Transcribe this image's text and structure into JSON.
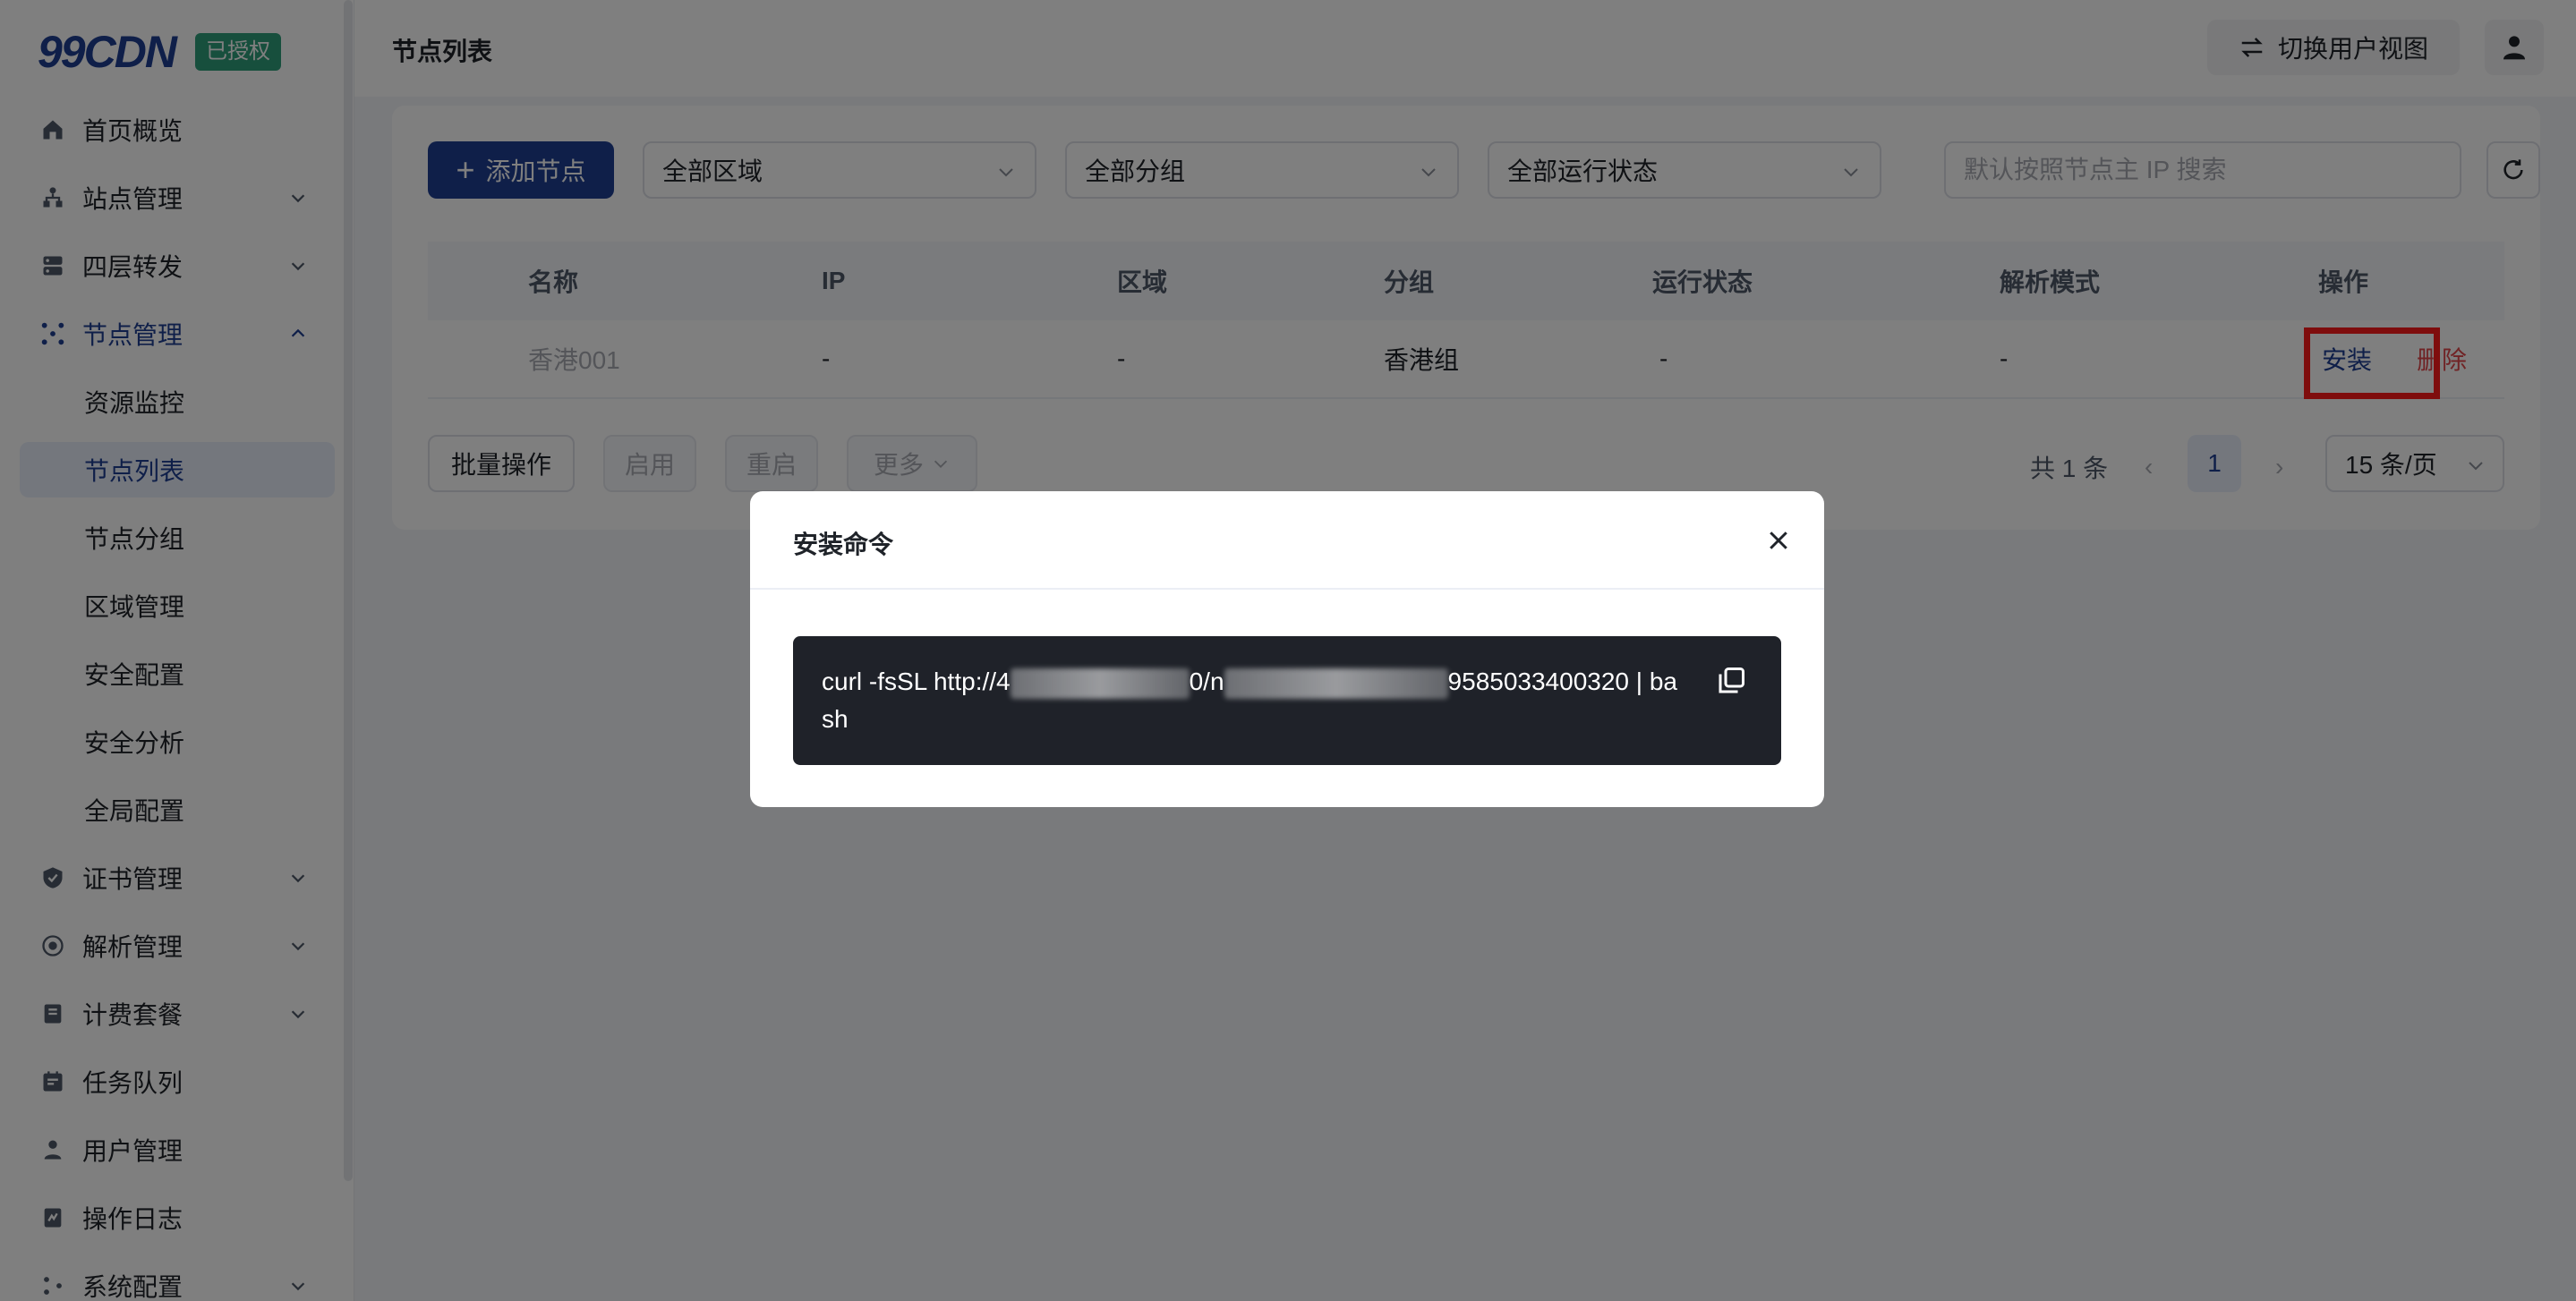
{
  "brand": {
    "logo": "99CDN",
    "license_badge": "已授权"
  },
  "header": {
    "page_title": "节点列表",
    "switch_view_label": "切换用户视图"
  },
  "sidebar": {
    "items": [
      {
        "label": "首页概览",
        "icon": "home-icon"
      },
      {
        "label": "站点管理",
        "icon": "site-icon",
        "expandable": true
      },
      {
        "label": "四层转发",
        "icon": "server-icon",
        "expandable": true
      },
      {
        "label": "节点管理",
        "icon": "nodes-icon",
        "expandable": true,
        "expanded": true,
        "children": [
          "资源监控",
          "节点列表",
          "节点分组",
          "区域管理",
          "安全配置",
          "安全分析",
          "全局配置"
        ],
        "active_child": "节点列表"
      },
      {
        "label": "证书管理",
        "icon": "shield-icon",
        "expandable": true
      },
      {
        "label": "解析管理",
        "icon": "dns-icon",
        "expandable": true
      },
      {
        "label": "计费套餐",
        "icon": "billing-icon",
        "expandable": true
      },
      {
        "label": "任务队列",
        "icon": "tasks-icon"
      },
      {
        "label": "用户管理",
        "icon": "user-icon"
      },
      {
        "label": "操作日志",
        "icon": "log-icon"
      },
      {
        "label": "系统配置",
        "icon": "settings-icon",
        "expandable": true
      }
    ]
  },
  "toolbar": {
    "add_node_label": "添加节点",
    "region_select": "全部区域",
    "group_select": "全部分组",
    "status_select": "全部运行状态",
    "search_placeholder": "默认按照节点主 IP 搜索"
  },
  "table": {
    "headers": [
      "名称",
      "IP",
      "区域",
      "分组",
      "运行状态",
      "解析模式",
      "操作"
    ],
    "rows": [
      {
        "name": "香港001",
        "ip": "-",
        "region": "-",
        "group": "香港组",
        "status": "-",
        "resolve_mode": "-",
        "actions": {
          "install": "安装",
          "delete": "删除"
        }
      }
    ]
  },
  "footer": {
    "batch_label": "批量操作",
    "enable_label": "启用",
    "restart_label": "重启",
    "more_label": "更多",
    "total_label": "共 1 条",
    "current_page": "1",
    "page_size_label": "15 条/页"
  },
  "modal": {
    "title": "安装命令",
    "command_prefix": "curl -fsSL http://4",
    "command_mid": "0/n",
    "command_suffix": "9585033400320 | bash"
  },
  "colors": {
    "primary": "#1f3f93",
    "danger": "#e0474a",
    "highlight": "#ff1a1a",
    "badge": "#2f9e7a"
  }
}
